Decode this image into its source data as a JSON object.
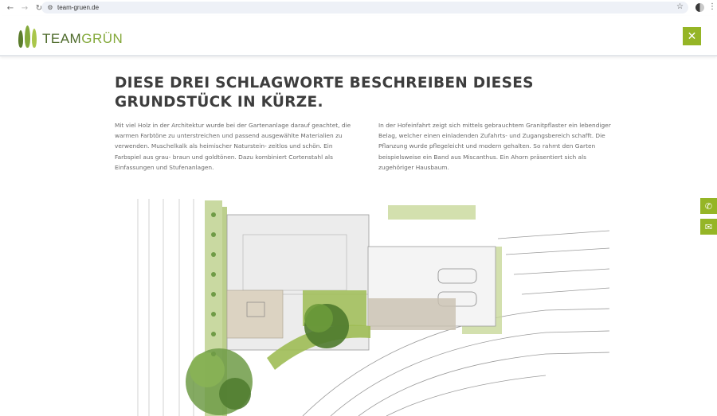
{
  "browser": {
    "url": "team-gruen.de",
    "back_icon": "arrow-left-icon",
    "forward_icon": "arrow-right-icon",
    "reload_icon": "reload-icon",
    "bookmark_icon": "star-icon"
  },
  "header": {
    "logo_text_main": "TEAM",
    "logo_text_accent": "GRÜN",
    "close_icon": "close-icon"
  },
  "colors": {
    "accent": "#95b526",
    "logo_dark": "#4d6a2a",
    "logo_light": "#84a93b",
    "headline": "#3d3d3d",
    "body_text": "#6a6a6a"
  },
  "content": {
    "headline": "DIESE DREI SCHLAGWORTE BESCHREIBEN DIESES GRUNDSTÜCK IN KÜRZE.",
    "paragraph_left": "Mit viel Holz in der Architektur wurde bei der Gartenanlage darauf geachtet, die warmen Farbtöne zu unterstreichen und passend ausgewählte Materialien zu verwenden. Muschelkalk als heimischer Naturstein- zeitlos und schön. Ein Farbspiel aus grau- braun und goldtönen. Dazu kombiniert Cortenstahl als Einfassungen und Stufenanlagen.",
    "paragraph_right": "In der Hofeinfahrt zeigt sich mittels gebrauchtem Granitpflaster ein lebendiger Belag, welcher einen einladenden Zufahrts- und Zugangsbereich schafft. Die Pflanzung wurde pflegeleicht und modern gehalten. So rahmt den Garten beispielsweise ein Band aus Miscanthus. Ein Ahorn präsentiert sich als zugehöriger Hausbaum."
  },
  "side_buttons": {
    "phone_icon": "phone-icon",
    "mail_icon": "mail-icon"
  }
}
